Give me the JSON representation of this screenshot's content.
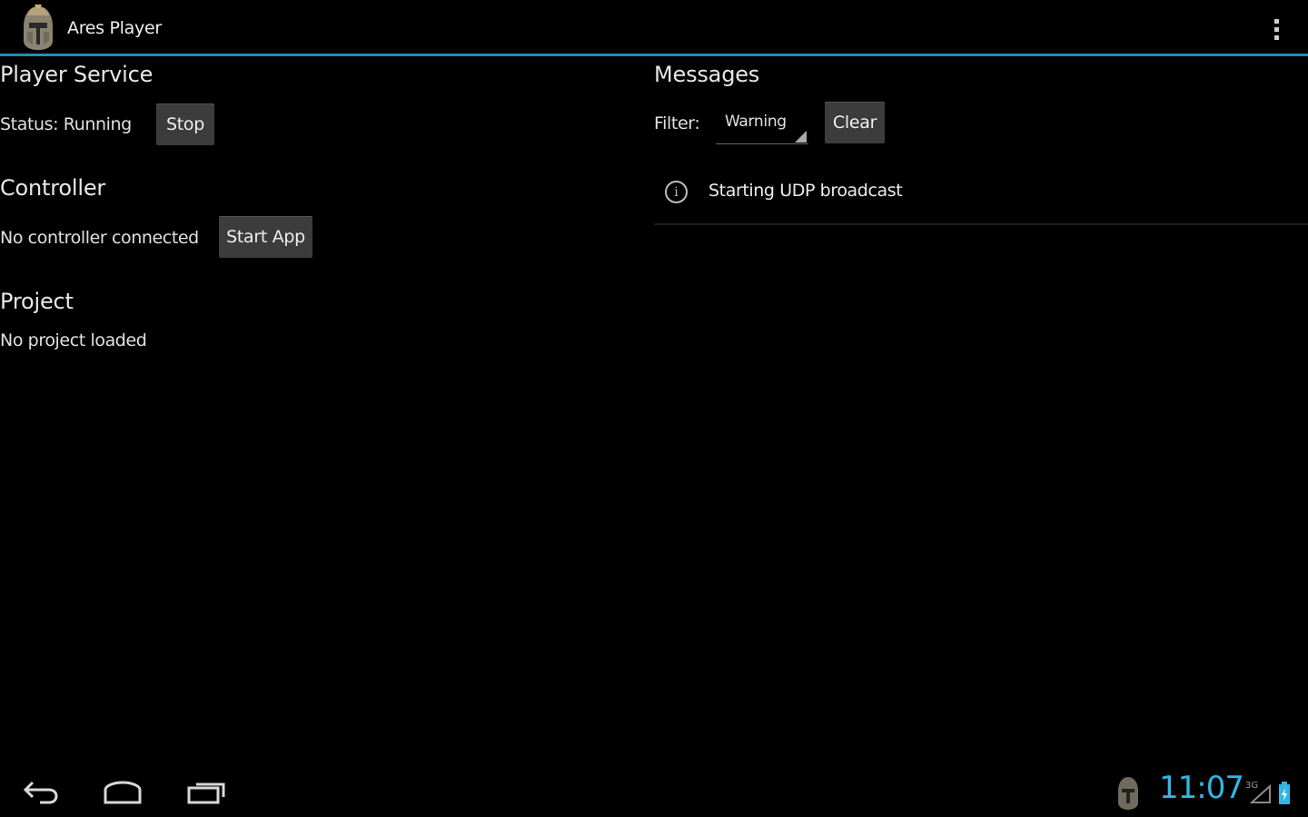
{
  "app": {
    "title": "Ares Player",
    "icon": "helmet-logo-icon",
    "overflow_icon": "overflow-menu-icon"
  },
  "player_service": {
    "heading": "Player Service",
    "status_text": "Status: Running",
    "stop_label": "Stop"
  },
  "controller": {
    "heading": "Controller",
    "status_text": "No controller connected",
    "start_label": "Start App"
  },
  "project": {
    "heading": "Project",
    "status_text": "No project loaded"
  },
  "messages": {
    "heading": "Messages",
    "filter_label": "Filter:",
    "filter_selected": "Warning",
    "clear_label": "Clear",
    "items": [
      {
        "icon": "info-icon",
        "text": "Starting UDP broadcast"
      }
    ]
  },
  "system_bar": {
    "clock": "11:07",
    "signal_label": "3G",
    "icons": [
      "back-icon",
      "home-icon",
      "recent-apps-icon",
      "notification-app-icon",
      "signal-icon",
      "battery-icon"
    ]
  },
  "colors": {
    "accent": "#33b5e5",
    "divider": "#2a8ab8",
    "button_bg": "#3c3c3c",
    "background": "#000000"
  }
}
